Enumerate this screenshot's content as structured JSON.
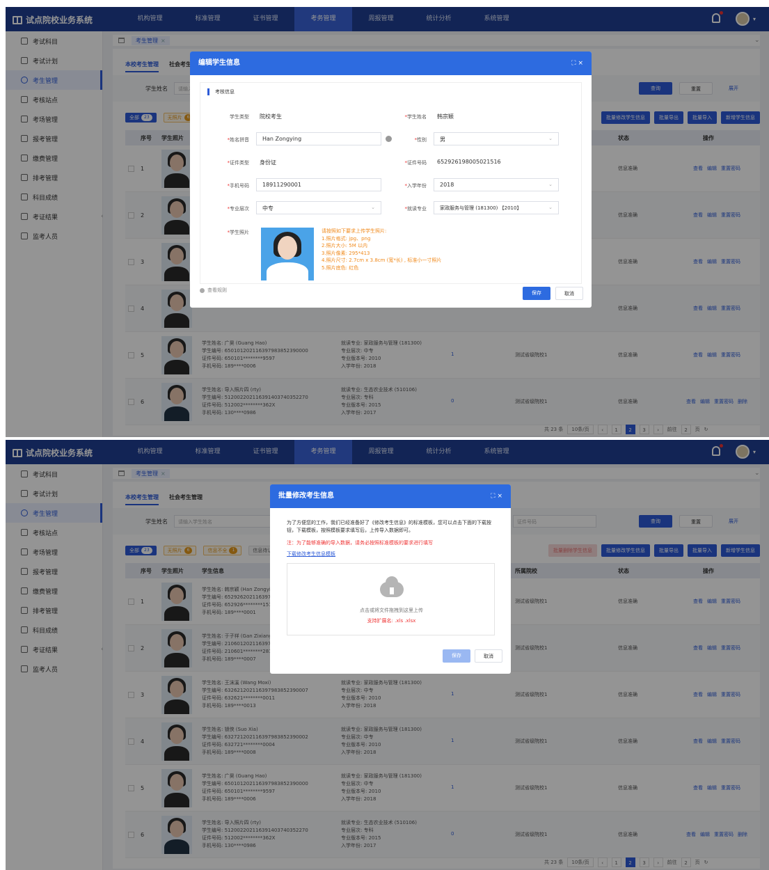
{
  "app": {
    "brand": "试点院校业务系统",
    "nav": [
      "机构管理",
      "标准管理",
      "证书管理",
      "考务管理",
      "周报管理",
      "统计分析",
      "系统管理"
    ],
    "nav_active": 3,
    "sidebar": [
      "考试科目",
      "考试计划",
      "考生管理",
      "考核站点",
      "考场管理",
      "报考管理",
      "缴费管理",
      "排考管理",
      "科目成绩",
      "考证结果",
      "监考人员"
    ],
    "sidebar_active": 2,
    "tab_label": "考生管理",
    "tab_close": "×"
  },
  "list": {
    "subtabs": [
      "本校考生管理",
      "社会考生管理"
    ],
    "search_label_name": "学生姓名",
    "search_placeholder_name": "请输入学生姓名",
    "search_placeholder_cert": "证件号码",
    "btn_query": "查询",
    "btn_reset": "重置",
    "btn_expand": "展开",
    "pills": [
      {
        "label": "全部",
        "count": "23"
      },
      {
        "label": "无照片",
        "count": "6"
      },
      {
        "label": "信息不全",
        "count": "1"
      },
      {
        "label": "信息待认证",
        "count": ""
      }
    ],
    "toolbar": [
      "批量删除学生信息",
      "批量修改学生信息",
      "批量导出",
      "批量导入",
      "新增学生信息"
    ],
    "columns": {
      "idx": "序号",
      "photo": "学生照片",
      "info": "学生信息",
      "school": "所属院校",
      "status": "状态",
      "ops": "操作"
    },
    "rows": [
      {
        "idx": "1",
        "name": "学生姓名: 韩宗颖 (Han Zongying)",
        "code": "学生编号: 652926202116397983852390",
        "cert": "证件号码: 652926********1516",
        "phone": "手机号码: 189****0001",
        "major": "就读专业: 家政服务与管理 (181300)",
        "level": "专业层次: 中专",
        "ver": "专业版本号: 2010",
        "year": "入学年份: 2018",
        "num": "1",
        "school": "测试省级院校1",
        "status": "信息准确",
        "ops": [
          "查看",
          "编辑",
          "重置密码"
        ],
        "male": false
      },
      {
        "idx": "2",
        "name": "学生姓名: 于子祥 (Gan Zixiang)",
        "code": "学生编号: 210601202116397983852390",
        "cert": "证件号码: 210601********2819",
        "phone": "手机号码: 189****0007",
        "major": "就读专业: 家政服务与管理 (181300)",
        "level": "专业层次: 中专",
        "ver": "专业版本号: 2010",
        "year": "入学年份: 2018",
        "num": "1",
        "school": "测试省级院校1",
        "status": "信息准确",
        "ops": [
          "查看",
          "编辑",
          "重置密码"
        ],
        "male": false
      },
      {
        "idx": "3",
        "name": "学生姓名: 王沫溪 (Wang Moxi)",
        "code": "学生编号: 632621202116397983852390007",
        "cert": "证件号码: 632621********0011",
        "phone": "手机号码: 189****0013",
        "major": "就读专业: 家政服务与管理 (181300)",
        "level": "专业层次: 中专",
        "ver": "专业版本号: 2010",
        "year": "入学年份: 2018",
        "num": "1",
        "school": "测试省级院校1",
        "status": "信息准确",
        "ops": [
          "查看",
          "编辑",
          "重置密码"
        ],
        "male": false
      },
      {
        "idx": "4",
        "name": "学生姓名: 锁侠 (Suo Xia)",
        "code": "学生编号: 632721202116397983852390002",
        "cert": "证件号码: 632721********0004",
        "phone": "手机号码: 189****0008",
        "major": "就读专业: 家政服务与管理 (181300)",
        "level": "专业层次: 中专",
        "ver": "专业版本号: 2010",
        "year": "入学年份: 2018",
        "num": "1",
        "school": "测试省级院校1",
        "status": "信息准确",
        "ops": [
          "查看",
          "编辑",
          "重置密码"
        ],
        "male": false
      },
      {
        "idx": "5",
        "name": "学生姓名: 广昊 (Guang Hao)",
        "code": "学生编号: 650101202116397983852390000",
        "cert": "证件号码: 650101********9597",
        "phone": "手机号码: 189****0006",
        "major": "就读专业: 家政服务与管理 (181300)",
        "level": "专业层次: 中专",
        "ver": "专业版本号: 2010",
        "year": "入学年份: 2018",
        "num": "1",
        "school": "测试省级院校1",
        "status": "信息准确",
        "ops": [
          "查看",
          "编辑",
          "重置密码"
        ],
        "male": false
      },
      {
        "idx": "6",
        "name": "学生姓名: 导入照片四 (rty)",
        "code": "学生编号: 512002202116391403740352270",
        "cert": "证件号码: 512002********362X",
        "phone": "手机号码: 130****0986",
        "major": "就读专业: 生态农业技术 (510106)",
        "level": "专业层次: 专科",
        "ver": "专业版本号: 2015",
        "year": "入学年份: 2017",
        "num": "0",
        "school": "测试省级院校1",
        "status": "信息准确",
        "ops": [
          "查看",
          "编辑",
          "重置密码",
          "删除"
        ],
        "male": true
      }
    ],
    "pager": {
      "total": "共 23 条",
      "size": "10条/页",
      "pages": [
        "1",
        "2",
        "3"
      ],
      "current": "2",
      "goto_label": "前往",
      "goto_value": "2",
      "page_unit": "页"
    }
  },
  "edit_modal": {
    "title": "编辑学生信息",
    "ctl": "⛶ ×",
    "section": "考核信息",
    "student_type_label": "学生类型",
    "student_type": "院校考生",
    "name_label": "学生姓名",
    "name": "韩宗颖",
    "pinyin_label": "姓名拼音",
    "pinyin": "Han Zongying",
    "gender_label": "性别",
    "gender": "男",
    "idtype_label": "证件类型",
    "idtype": "身份证",
    "idno_label": "证件号码",
    "idno": "652926198005021516",
    "phone_label": "手机号码",
    "phone": "18911290001",
    "year_label": "入学年份",
    "year": "2018",
    "level_label": "专业层次",
    "level": "中专",
    "major_label": "就读专业",
    "major": "家政服务与管理 (181300) 【2010】",
    "photo_label": "学生照片",
    "photo_req": [
      "请按照如下要求上传学生照片:",
      "1.照片格式: jpg、png",
      "2.照片大小: 5M 以内",
      "3.照片像素: 295*413",
      "4.照片尺寸: 2.7cm x 3.8cm (宽*长) , 标准小一寸照片",
      "5.照片底色: 红色"
    ],
    "rule_link": "查看规则",
    "save": "保存",
    "cancel": "取消"
  },
  "batch_modal": {
    "title": "批量修改考生信息",
    "ctl": "⛶ ×",
    "desc": "为了方便您的工作，我们已经准备好了《修改考生信息》的标准模板，您可以点击下面的下载按钮，下载模板，按照模板要求填写后，上传导入数据即可。",
    "warn": "注：为了能够准确的导入数据，请务必按照标准模板的要求进行填写",
    "download": "下载修改考生信息模板",
    "drop_hint": "点击或将文件拖拽到这里上传",
    "ext_hint": "支持扩展名: .xls .xlsx",
    "save": "保存",
    "cancel": "取消"
  },
  "colors": {
    "topbar": "#1f3f93",
    "primary": "#2d5bd7",
    "modal_header": "#2d6be0",
    "warn_orange": "#f08a1c",
    "error_red": "#e33"
  }
}
